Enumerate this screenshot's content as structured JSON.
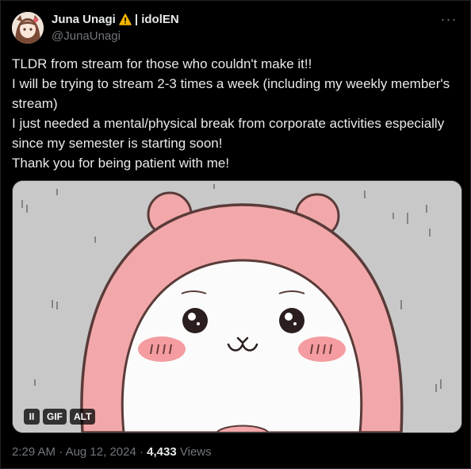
{
  "author": {
    "display_name": "Juna Unagi",
    "badge_icon": "warning-icon",
    "affiliation": "| idolEN",
    "handle": "@JunaUnagi",
    "avatar_icon": "avatar-illustration"
  },
  "menu": {
    "more_icon": "more-horizontal-icon",
    "more_glyph": "···"
  },
  "tweet": {
    "lines": [
      "TLDR from stream for those who couldn't make it!!",
      "I will be trying to stream 2-3 times a week (including my weekly member's stream)",
      "I just needed a mental/physical break from corporate activities especially since my semester is starting soon!",
      "Thank you for being patient with me!"
    ]
  },
  "media": {
    "type": "gif",
    "pause_label": "II",
    "gif_label": "GIF",
    "alt_label": "ALT"
  },
  "meta": {
    "time": "2:29 AM",
    "separator": "·",
    "date": "Aug 12, 2024",
    "views_count": "4,433",
    "views_label": "Views"
  },
  "colors": {
    "background": "#000000",
    "primary_text": "#e7e9ea",
    "secondary_text": "#71767b",
    "warning_badge": "#f4b400",
    "hood_pink": "#f2a8aa",
    "cheek_pink": "#f49c9f"
  }
}
